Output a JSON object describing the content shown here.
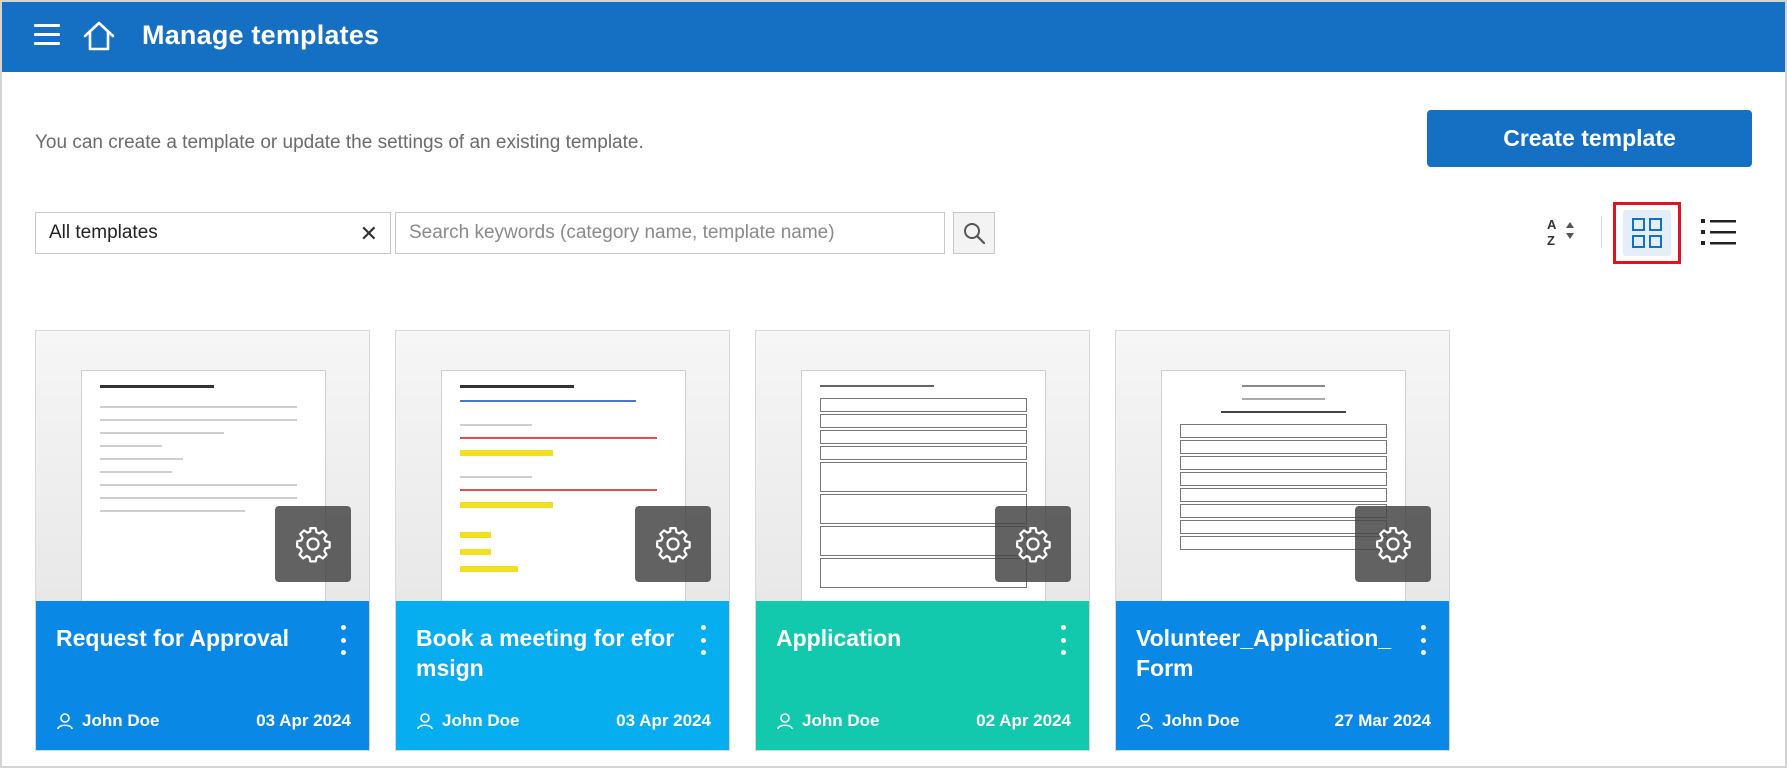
{
  "header": {
    "title": "Manage templates"
  },
  "intro": {
    "text": "You can create a template or update the settings of an existing template."
  },
  "actions": {
    "create_label": "Create template"
  },
  "filters": {
    "category_value": "All templates",
    "search_placeholder": "Search keywords (category name, template name)"
  },
  "view": {
    "sort_icon": "sort-az-icon",
    "grid_icon": "grid-view-icon",
    "list_icon": "list-view-icon",
    "selected": "grid"
  },
  "cards": [
    {
      "name": "Request for Approval",
      "author": "John Doe",
      "date": "03 Apr 2024",
      "color": "#0a88e6"
    },
    {
      "name": "Book a meeting for eformsign",
      "author": "John Doe",
      "date": "03 Apr 2024",
      "color": "#06aef0"
    },
    {
      "name": "Application",
      "author": "John Doe",
      "date": "02 Apr 2024",
      "color": "#12c8ad"
    },
    {
      "name": "Volunteer_Application_Form",
      "author": "John Doe",
      "date": "27 Mar 2024",
      "color": "#0a88e6"
    }
  ]
}
